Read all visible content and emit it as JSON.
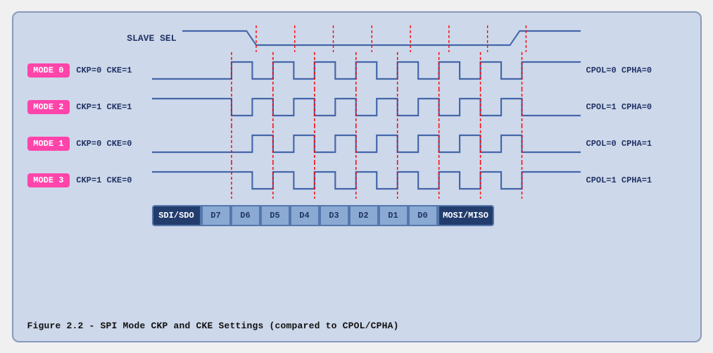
{
  "diagram": {
    "title": "Figure 2.2 - SPI Mode CKP and CKE Settings (compared to CPOL/CPHA)",
    "slave_label": "SLAVE SEL",
    "modes": [
      {
        "badge": "MODE 0",
        "params": "CKP=0  CKE=1",
        "right": "CPOL=0  CPHA=0",
        "type": "high_idle"
      },
      {
        "badge": "MODE 2",
        "params": "CKP=1  CKE=1",
        "right": "CPOL=1  CPHA=0",
        "type": "low_idle"
      },
      {
        "badge": "MODE 1",
        "params": "CKP=0  CKE=0",
        "right": "CPOL=0  CPHA=1",
        "type": "high_idle_phase"
      },
      {
        "badge": "MODE 3",
        "params": "CKP=1  CKE=0",
        "right": "CPOL=1  CPHA=1",
        "type": "low_idle_phase"
      }
    ],
    "data_bits": [
      "SDI/SDO",
      "D7",
      "D6",
      "D5",
      "D4",
      "D3",
      "D2",
      "D1",
      "D0",
      "MOSI/MISO"
    ]
  }
}
